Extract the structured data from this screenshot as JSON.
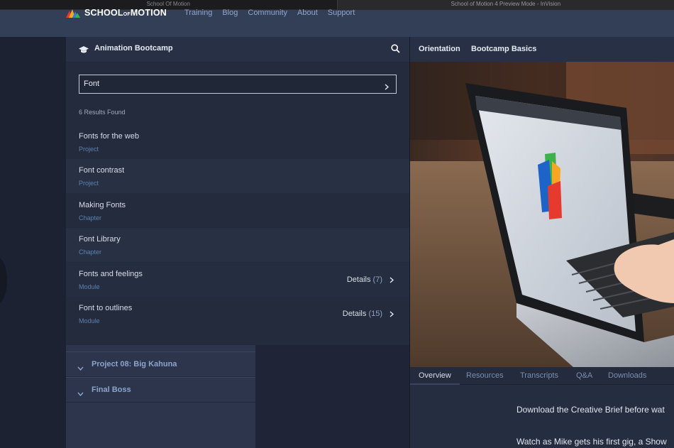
{
  "browser": {
    "tabs": [
      "School Of Motion",
      "School of Motion 4 Preview Mode - InVision"
    ]
  },
  "header": {
    "logo_text": "SCHOOL",
    "logo_of": "OF",
    "logo_text2": "MOTION",
    "nav": [
      "Training",
      "Blog",
      "Community",
      "About",
      "Support"
    ]
  },
  "course": {
    "title": "Animation Bootcamp"
  },
  "search": {
    "value": "Font",
    "results_count": "6 Results Found",
    "results": [
      {
        "name": "Fonts for the web",
        "type": "Project"
      },
      {
        "name": "Font contrast",
        "type": "Project"
      },
      {
        "name": "Making Fonts",
        "type": "Chapter"
      },
      {
        "name": "Font Library",
        "type": "Chapter"
      },
      {
        "name": "Fonts and feelings",
        "type": "Module",
        "details": "Details",
        "count": "(7)"
      },
      {
        "name": "Font to outlines",
        "type": "Module",
        "details": "Details",
        "count": "(15)"
      }
    ]
  },
  "sections": [
    {
      "label": "Project 08: Big Kahuna"
    },
    {
      "label": "Final Boss"
    }
  ],
  "lesson": {
    "breadcrumb": [
      "Orientation",
      "Bootcamp Basics"
    ],
    "tabs": [
      "Overview",
      "Resources",
      "Transcripts",
      "Q&A",
      "Downloads"
    ],
    "active_tab": "Overview",
    "description": [
      "Download the Creative Brief before wat",
      "Watch as Mike gets his first gig, a Show"
    ]
  },
  "colors": {
    "nav_bg": "#333e57",
    "panel_bg": "#232b3c",
    "type_label": "#5e81b0",
    "section_label": "#8ca4cc"
  },
  "icons": [
    "graduation-cap-icon",
    "search-icon",
    "chevron-right-icon",
    "chevron-down-icon"
  ]
}
